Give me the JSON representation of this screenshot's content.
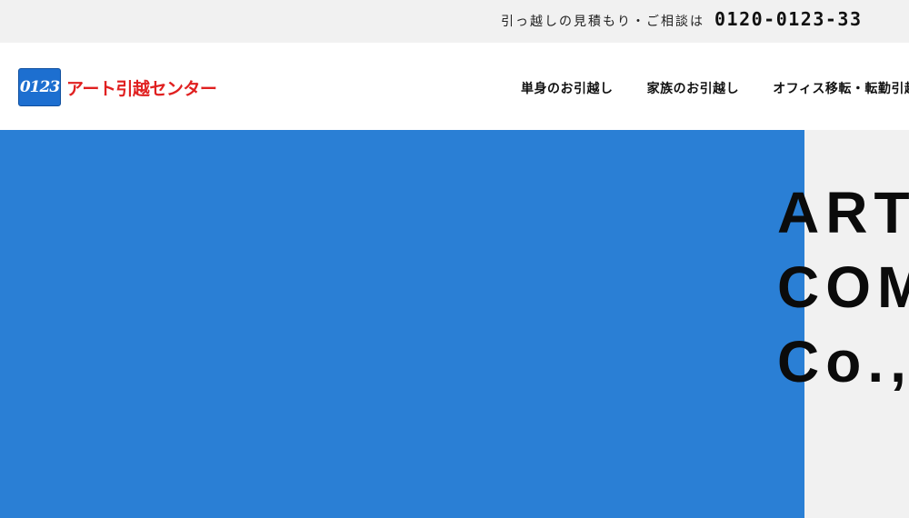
{
  "topbar": {
    "contact_text": "引っ越しの見積もり・ご相談は",
    "phone": "0120-0123-33"
  },
  "header": {
    "logo_badge": "0123",
    "logo_name": "アート引越センター",
    "nav": [
      {
        "label": "単身のお引越し"
      },
      {
        "label": "家族のお引越し"
      },
      {
        "label": "オフィス移転・転勤引越し"
      }
    ]
  },
  "hero": {
    "title_lines": [
      "ART",
      "COM",
      "Co.,"
    ]
  },
  "colors": {
    "topbar_bg": "#f1f1f1",
    "hero_blue": "#2a7fd5",
    "logo_blue": "#1d6fd0",
    "logo_red": "#e02020"
  }
}
